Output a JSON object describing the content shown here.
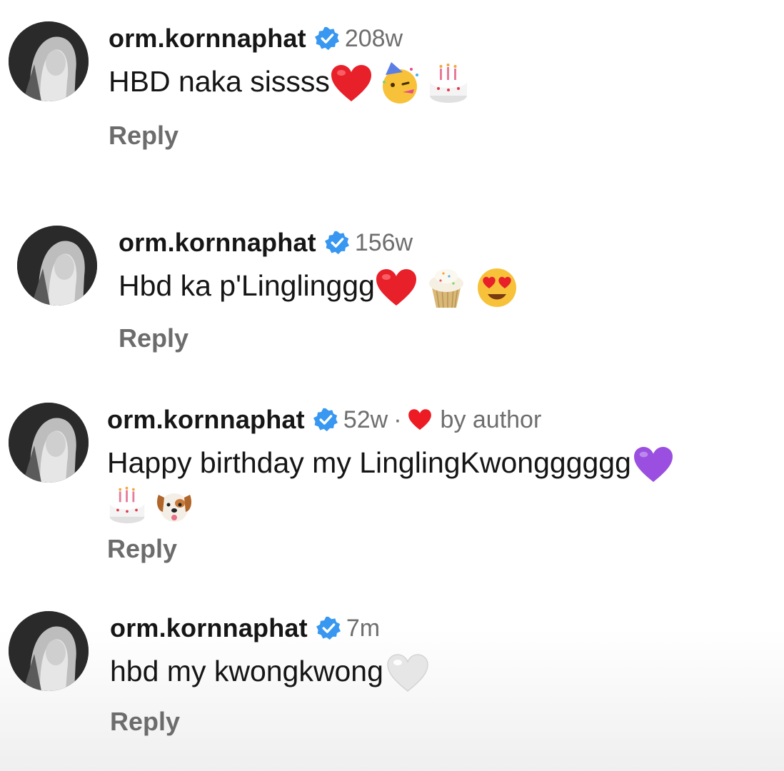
{
  "comments": [
    {
      "username": "orm.kornnaphat",
      "timestamp": "208w",
      "text": "HBD naka sissss",
      "emojis": [
        "red-heart",
        "partying-face",
        "birthday-cake"
      ],
      "reply_label": "Reply"
    },
    {
      "username": "orm.kornnaphat",
      "timestamp": "156w",
      "text": "Hbd ka p'Linglinggg",
      "emojis": [
        "red-heart",
        "cupcake",
        "heart-eyes-face"
      ],
      "reply_label": "Reply"
    },
    {
      "username": "orm.kornnaphat",
      "timestamp": "52w",
      "separator": "·",
      "liked_by": "by author",
      "text": "Happy birthday my LinglingKwongggggg",
      "emojis": [
        "purple-heart",
        "birthday-cake",
        "dog-face"
      ],
      "reply_label": "Reply"
    },
    {
      "username": "orm.kornnaphat",
      "timestamp": "7m",
      "text": "hbd my kwongkwong",
      "emojis": [
        "white-heart"
      ],
      "reply_label": "Reply"
    }
  ],
  "colors": {
    "username": "#161616",
    "meta": "#6e6e6e",
    "verified_badge": "#3897f0",
    "liked_heart": "#ed1c24",
    "purple_heart": "#9b4fe0",
    "white_heart": "#e6e6e6"
  }
}
